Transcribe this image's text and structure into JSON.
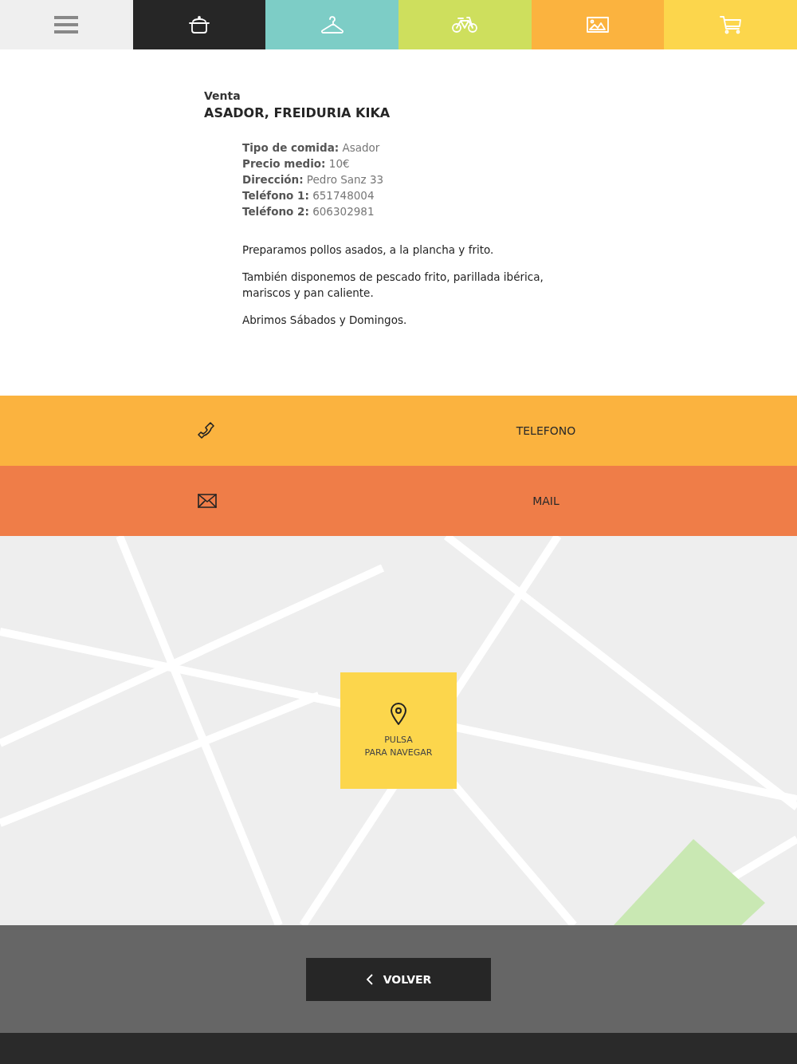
{
  "nav": [
    {
      "kind": "menu",
      "color": "#efefef"
    },
    {
      "kind": "pot",
      "color": "#262626"
    },
    {
      "kind": "hanger",
      "color": "#7dcdc6"
    },
    {
      "kind": "bicycle",
      "color": "#cedf5d"
    },
    {
      "kind": "picture",
      "color": "#fbb33f"
    },
    {
      "kind": "cart",
      "color": "#fcd64c"
    }
  ],
  "listing": {
    "category": "Venta",
    "title": "ASADOR, FREIDURIA KIKA",
    "details": [
      "**Tipo de comida:** Asador",
      "**Precio medio:** 10€",
      "**Dirección:** Pedro Sanz 33",
      "**Teléfono 1:** 651748004",
      "**Teléfono 2:** 606302981"
    ],
    "paragraphs": [
      "Preparamos pollos asados, a la plancha y frito.",
      "También disponemos de pescado frito, parillada ibérica, mariscos y pan caliente.",
      "Abrimos Sábados y Domingos."
    ]
  },
  "contacts": [
    {
      "kind": "phone",
      "label": "TELEFONO",
      "color": "#fbb33f"
    },
    {
      "kind": "mail",
      "label": "MAIL",
      "color": "#ef7d48"
    }
  ],
  "map": {
    "navigate_button": [
      "PULSA",
      "PARA NAVEGAR"
    ]
  },
  "back_button": "VOLVER"
}
